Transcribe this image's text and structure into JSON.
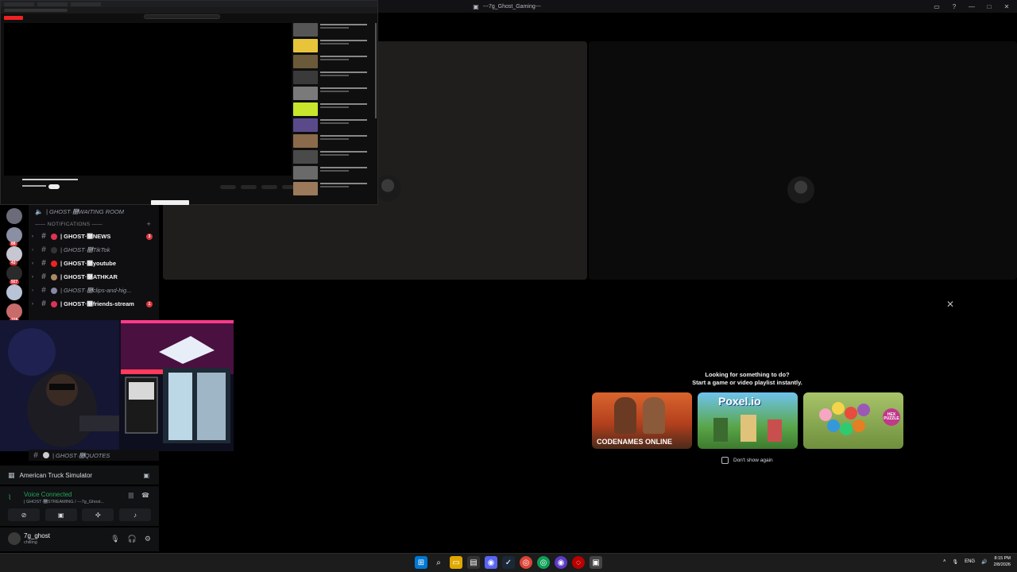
{
  "window": {
    "title": "---7g_Ghost_Gaming---",
    "icons": [
      "discord-icon",
      "minimize-icon",
      "maximize-icon",
      "close-icon",
      "inbox-icon",
      "help-icon"
    ]
  },
  "channels": {
    "waiting_room": "| GHOST·࿥WAITING ROOM",
    "category": "NOTIFICATIONS",
    "items": [
      {
        "label": "| GHOST·࿥NEWS",
        "badge": "3",
        "bright": true
      },
      {
        "label": "| GHOST·࿥TikTok",
        "badge": "",
        "bright": false
      },
      {
        "label": "| GHOST·࿥youtube",
        "badge": "",
        "bright": true
      },
      {
        "label": "| GHOST·࿥ATHKAR",
        "badge": "",
        "bright": true
      },
      {
        "label": "| GHOST·࿥clips-and-hig...",
        "badge": "",
        "bright": false
      },
      {
        "label": "| GHOST·࿥friends-stream",
        "badge": "1",
        "bright": true
      }
    ],
    "quotes": "| GHOST·࿥QUOTES"
  },
  "servers": [
    {
      "color": "#6b6b7a",
      "count": ""
    },
    {
      "color": "#8a8fa3",
      "count": "88"
    },
    {
      "color": "#c7c7d1",
      "count": "43"
    },
    {
      "color": "#2a2a2a",
      "count": "927"
    },
    {
      "color": "#b9c3d6",
      "count": ""
    },
    {
      "color": "#c76b6b",
      "count": "328"
    }
  ],
  "activity": {
    "game": "American Truck Simulator"
  },
  "voice": {
    "status": "Voice Connected",
    "channel": "| GHOST·࿥STREAMING / ---7g_Ghost..."
  },
  "user": {
    "name": "7g_ghost",
    "status": "chilling"
  },
  "activity_modal": {
    "line1": "Looking for something to do?",
    "line2": "Start a game or video playlist instantly.",
    "games": [
      "CODENAMES ONLINE",
      "Poxel.io",
      "HEX PUZZLE"
    ],
    "checkbox_label": "Don't show again"
  },
  "taskbar": {
    "lang": "ENG",
    "time": "8:15 PM",
    "date": "2/8/2026"
  }
}
